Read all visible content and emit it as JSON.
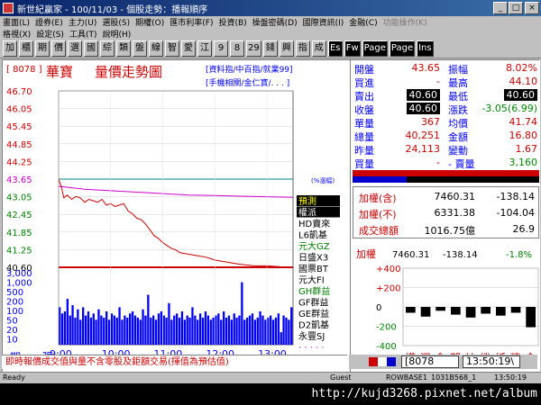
{
  "window": {
    "title": "新世紀贏家 - 100/11/03 - 個股走勢：播報順序"
  },
  "menu": [
    {
      "label": "畫面(L)",
      "dim": false
    },
    {
      "label": "證券(E)",
      "dim": false
    },
    {
      "label": "主力(U)",
      "dim": false
    },
    {
      "label": "選股(S)",
      "dim": false
    },
    {
      "label": "期權(O)",
      "dim": false
    },
    {
      "label": "匯市利率(F)",
      "dim": false
    },
    {
      "label": "投資(B)",
      "dim": false
    },
    {
      "label": "操盤密碼(D)",
      "dim": false
    },
    {
      "label": "國際資訊(I)",
      "dim": false
    },
    {
      "label": "金融(C)",
      "dim": false
    },
    {
      "label": "功能操作(K)",
      "dim": true
    }
  ],
  "menu2": [
    "格視(X)",
    "設定(S)",
    "工具(T)",
    "說明(H)"
  ],
  "toolbar": [
    {
      "label": "加",
      "black": false
    },
    {
      "label": "櫃",
      "black": false
    },
    {
      "label": "期",
      "black": false
    },
    {
      "label": "價",
      "black": false
    },
    {
      "label": "選",
      "black": false
    },
    {
      "label": "國",
      "black": false
    },
    {
      "label": "綜",
      "black": false
    },
    {
      "label": "類",
      "black": false
    },
    {
      "label": "盤",
      "black": false
    },
    {
      "label": "線",
      "black": false
    },
    {
      "label": "智",
      "black": false
    },
    {
      "label": "愛",
      "black": false
    },
    {
      "label": "江",
      "black": false
    },
    {
      "label": "9",
      "black": false
    },
    {
      "label": "8",
      "black": false
    },
    {
      "label": "29",
      "black": false
    },
    {
      "label": "錢",
      "black": false
    },
    {
      "label": "興",
      "black": false
    },
    {
      "label": "指",
      "black": false
    },
    {
      "label": "成",
      "black": false
    },
    {
      "label": "Es",
      "black": true
    },
    {
      "label": "Fw",
      "black": true
    },
    {
      "label": "Page",
      "black": true
    },
    {
      "label": "Page",
      "black": true
    },
    {
      "label": "Ins",
      "black": true
    }
  ],
  "chart_header": {
    "code": "[ 8078 ]",
    "name": "華寶",
    "title": "量價走勢圖",
    "hint1": "[資料指/中百指/就業99]",
    "hint2": "[手機相關/金仁寶/. . . ]"
  },
  "colors": {
    "price_line": "#cc0000",
    "avg_line": "#cc00cc",
    "volume": "#0000ff",
    "ref_line": "#008080",
    "up": "#cc0000",
    "down": "#008000",
    "label": "#0000ff"
  },
  "chart_data": {
    "type": "line",
    "price_ticks": [
      "46.70",
      "46.05",
      "45.45",
      "44.85",
      "44.25",
      "43.65",
      "43.05",
      "42.45",
      "41.85",
      "41.25",
      "40.60"
    ],
    "ylim": [
      40.6,
      46.7
    ],
    "ref_price": 43.65,
    "last_price": 40.6,
    "x_ticks": [
      "9:00",
      "10:00",
      "11:00",
      "12:00",
      "13:00"
    ],
    "volume_ticks": [
      "3,000",
      "1,000",
      "500",
      "200",
      "100",
      "50",
      "20",
      "10"
    ],
    "volume_unit_label": "張",
    "period_label": "期",
    "ref_tag": "(%漲幅)",
    "price_series": [
      [
        0,
        43.65
      ],
      [
        3,
        43.4
      ],
      [
        6,
        43.0
      ],
      [
        10,
        43.1
      ],
      [
        15,
        42.95
      ],
      [
        20,
        43.05
      ],
      [
        25,
        43.0
      ],
      [
        30,
        42.85
      ],
      [
        35,
        42.95
      ],
      [
        40,
        42.9
      ],
      [
        45,
        42.85
      ],
      [
        50,
        42.95
      ],
      [
        55,
        42.75
      ],
      [
        60,
        42.8
      ],
      [
        65,
        42.7
      ],
      [
        70,
        42.75
      ],
      [
        75,
        42.8
      ],
      [
        80,
        42.55
      ],
      [
        85,
        42.45
      ],
      [
        90,
        42.3
      ],
      [
        95,
        42.25
      ],
      [
        100,
        42.1
      ],
      [
        105,
        41.9
      ],
      [
        110,
        41.7
      ],
      [
        115,
        41.6
      ],
      [
        120,
        41.45
      ],
      [
        125,
        41.35
      ],
      [
        130,
        41.25
      ],
      [
        135,
        41.2
      ],
      [
        140,
        41.1
      ],
      [
        150,
        41.05
      ],
      [
        160,
        41.0
      ],
      [
        170,
        40.95
      ],
      [
        180,
        40.85
      ],
      [
        190,
        40.8
      ],
      [
        200,
        40.75
      ],
      [
        210,
        40.7
      ],
      [
        225,
        40.65
      ],
      [
        240,
        40.65
      ],
      [
        255,
        40.62
      ],
      [
        270,
        40.6
      ]
    ],
    "avg_series": [
      [
        0,
        43.4
      ],
      [
        30,
        43.3
      ],
      [
        60,
        43.25
      ],
      [
        90,
        43.2
      ],
      [
        120,
        43.15
      ],
      [
        150,
        43.1
      ],
      [
        180,
        43.08
      ],
      [
        210,
        43.06
      ],
      [
        240,
        43.04
      ],
      [
        270,
        43.02
      ]
    ],
    "volume": [
      900,
      750,
      800,
      1100,
      700,
      950,
      650,
      850,
      600,
      900,
      700,
      800,
      650,
      750,
      600,
      850,
      700,
      650,
      800,
      600,
      750,
      700,
      650,
      900,
      600,
      700,
      650,
      750,
      800,
      700,
      650,
      600,
      850,
      700,
      1200,
      650,
      700,
      600,
      750,
      800,
      700,
      650,
      1000,
      600,
      700,
      750,
      650,
      800,
      600,
      700,
      650,
      900,
      700,
      600,
      750,
      650,
      800,
      700,
      600,
      650,
      700,
      750,
      600,
      800,
      650,
      700,
      600,
      750,
      650,
      700,
      1500,
      600,
      650,
      700,
      750,
      600,
      650,
      800,
      700,
      600,
      650,
      700,
      600,
      650,
      750,
      300,
      700,
      650,
      600,
      900
    ]
  },
  "side_labels": [
    {
      "text": "預測",
      "color": "#ffff00",
      "bg": "#000000"
    },
    {
      "text": "權派",
      "color": "#ffffff",
      "bg": "#000000"
    },
    {
      "text": "HD賣來",
      "color": "#000000",
      "bg": ""
    },
    {
      "text": "L6凱基",
      "color": "#000000",
      "bg": ""
    },
    {
      "text": "元大GZ",
      "color": "#008000",
      "bg": ""
    },
    {
      "text": "日盛X3",
      "color": "#000000",
      "bg": ""
    },
    {
      "text": "國票BT",
      "color": "#000000",
      "bg": ""
    },
    {
      "text": "元大FI",
      "color": "#000000",
      "bg": ""
    },
    {
      "text": "GH群益",
      "color": "#008000",
      "bg": ""
    },
    {
      "text": "GF群益",
      "color": "#000000",
      "bg": ""
    },
    {
      "text": "GE群益",
      "color": "#000000",
      "bg": ""
    },
    {
      "text": "D2凱基",
      "color": "#000000",
      "bg": ""
    },
    {
      "text": "永豐SJ",
      "color": "#000000",
      "bg": ""
    },
    {
      "text": "· · · · ·",
      "color": "#cc00cc",
      "bg": ""
    }
  ],
  "quote": {
    "rows": [
      {
        "l1": "開盤",
        "v1": "43.65",
        "l2": "振幅",
        "v2": "8.02%"
      },
      {
        "l1": "買進",
        "v1": "-",
        "l2": "最高",
        "v2": "44.10"
      },
      {
        "l1": "賣出",
        "v1": "40.60",
        "l2": "最低",
        "v2": "40.60"
      },
      {
        "l1": "收盤",
        "v1": "40.60",
        "l2": "漲跌",
        "v2": "-3.05(6.99)"
      },
      {
        "l1": "單量",
        "v1": "367",
        "l2": "均價",
        "v2": "41.74"
      },
      {
        "l1": "總量",
        "v1": "40,251",
        "l2": "金額",
        "v2": "16.80"
      },
      {
        "l1": "昨量",
        "v1": "24,113",
        "l2": "變動",
        "v2": "1.67"
      },
      {
        "l1": "買量",
        "v1": "-",
        "l2": "- 賣量",
        "v2": "3,160"
      }
    ]
  },
  "index": {
    "rows": [
      {
        "label": "加權(含)",
        "value": "7460.31",
        "change": "-138.14"
      },
      {
        "label": "加權(不)",
        "value": "6331.38",
        "change": "-104.04"
      },
      {
        "label": "成交總額",
        "value": "1016.75億",
        "change": "26.9"
      }
    ]
  },
  "mini": {
    "label": "加權",
    "value": "7460.31",
    "change": "-138.14",
    "pct": "-1.8%",
    "yticks": [
      "+400",
      "+200",
      "0",
      "-200",
      "-400"
    ],
    "ylim": [
      -400,
      400
    ],
    "sectors": [
      "權",
      "泥",
      "食",
      "塑",
      "紡",
      "機",
      "紙",
      "建",
      "金"
    ],
    "bar_values": [
      -60,
      -100,
      -40,
      -80,
      -110,
      -70,
      -90,
      -60,
      -210
    ]
  },
  "statusline": "即時報價成交值與量不含零股及鉅額交易(揮值為預估值)",
  "bottom": {
    "code": "[8078",
    "clock": "13:50:19\\"
  },
  "statusbar": {
    "ready": "Ready",
    "guest": "Guest",
    "server": "ROWBASE1",
    "ver": "1031B568_1",
    "time": "13:50:19"
  },
  "url": "http://kujd3268.pixnet.net/album"
}
